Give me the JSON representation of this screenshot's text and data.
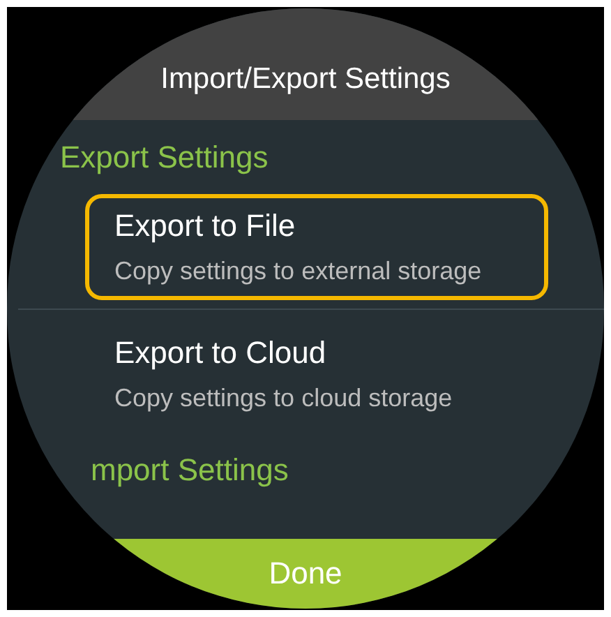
{
  "header": {
    "title": "Import/Export Settings"
  },
  "sections": [
    {
      "heading": "Export Settings",
      "items": [
        {
          "title": "Export to File",
          "subtitle": "Copy settings to external storage",
          "selected": true
        },
        {
          "title": "Export to Cloud",
          "subtitle": "Copy settings to cloud storage",
          "selected": false
        }
      ]
    },
    {
      "heading": "mport Settings"
    }
  ],
  "done_button": {
    "label": "Done"
  }
}
